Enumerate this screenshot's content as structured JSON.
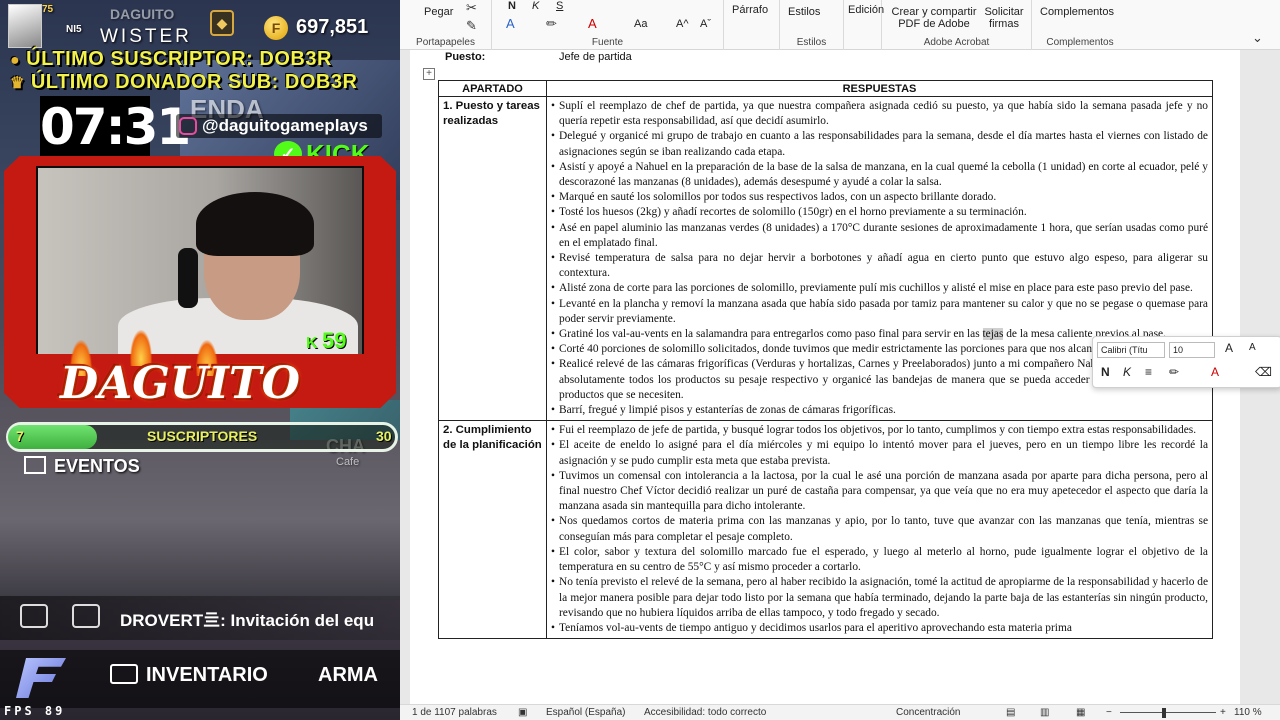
{
  "stream": {
    "player_name": "WISTER",
    "player_tag": "DAGUITO",
    "level": "75",
    "nis": "NI5",
    "coins": "697,851",
    "ticker1": "ÚLTIMO SUSCRIPTOR: DOB3R",
    "ticker2": "ÚLTIMO DONADOR SUB: DOB3R",
    "clock": "07:31",
    "instagram": "@daguitogameplays",
    "kick": "KICK",
    "kick_viewers": "59",
    "name_plate": "DAGUITO",
    "sub_current": "7",
    "sub_label": "SUSCRIPTORES",
    "sub_goal": "30",
    "sub_progress": 0.23,
    "events": "EVENTOS",
    "chat_message": "DROVERT亖: Invitación del equ",
    "inventory": "INVENTARIO",
    "weapon": "ARMA",
    "fps_label": "FPS",
    "fps_value": "89",
    "bg_text_1": "ENDA",
    "bg_text_2": "CHA",
    "bg_text_3": "Cafe"
  },
  "ribbon": {
    "pegar": "Pegar",
    "portapapeles": "Portapapeles",
    "fuente": "Fuente",
    "parrafo": "Párrafo",
    "estilos": "Estilos",
    "estilos_group": "Estilos",
    "edicion": "Edición",
    "crear_pdf": "Crear y compartir PDF de Adobe",
    "solicitar_firmas": "Solicitar firmas",
    "adobe_group": "Adobe Acrobat",
    "complementos": "Complementos",
    "complementos_group": "Complementos",
    "bold": "N",
    "italic": "K",
    "underline": "S",
    "grow": "A^",
    "shrink": "Aˇ",
    "aa": "Aa"
  },
  "mini_toolbar": {
    "font": "Calibri (Títu",
    "size": "10",
    "bold": "N",
    "italic": "K"
  },
  "document": {
    "puesto_label": "Puesto:",
    "puesto_value": "Jefe de partida",
    "col1": "APARTADO",
    "col2": "RESPUESTAS",
    "section1": "1. Puesto y tareas realizadas",
    "section1_items": [
      "Suplí el reemplazo de chef de partida, ya que nuestra compañera asignada cedió su puesto, ya que había sido la semana pasada jefe y no quería repetir esta responsabilidad, así que decidí asumirlo.",
      "Delegué y organicé mi grupo de trabajo en cuanto a las responsabilidades para la semana, desde el día martes hasta el viernes con listado de asignaciones según se iban realizando cada etapa.",
      "Asistí y apoyé a Nahuel en la preparación de la base de la salsa de manzana, en la cual quemé la cebolla (1 unidad) en corte al ecuador, pelé y descorazoné las manzanas (8 unidades), además desespumé y ayudé a colar la salsa.",
      "Marqué en sauté los solomillos por todos sus respectivos lados, con un aspecto brillante dorado.",
      "Tosté los huesos (2kg) y añadí recortes de solomillo (150gr) en el horno previamente a su terminación.",
      "Asé en papel aluminio las manzanas verdes (8 unidades) a 170°C durante sesiones de aproximadamente 1 hora, que serían usadas como puré en el emplatado final.",
      "Revisé temperatura de salsa para no dejar hervir a borbotones y añadí agua en cierto punto que estuvo algo espeso, para aligerar su contextura.",
      "Alisté zona de corte para las porciones de solomillo, previamente pulí mis cuchillos y alisté el mise en place para este paso previo del pase.",
      "Levanté en la plancha y removí la manzana asada que había sido pasada por tamiz para mantener su calor y que no se pegase o quemase para poder servir previamente.",
      "Gratiné los val-au-vents en la salamandra para entregarlos como paso final para servir en las tejas de la mesa caliente previos al pase.",
      "Corté 40 porciones de solomillo solicitados, donde tuvimos que medir estrictamente las porciones para que nos alcanzara dicha proteína.",
      "Realicé relevé de las cámaras frigoríficas (Verduras y hortalizas, Carnes y Preelaborados) junto a mi compañero Nahuel, en el cual escribí en absolutamente todos los productos su pesaje respectivo y organicé las bandejas de manera que se pueda acceder de manera sencilla a los productos que se necesiten.",
      "Barrí, fregué y limpié pisos y estanterías de zonas de cámaras frigoríficas."
    ],
    "section2": "2. Cumplimiento de la planificación",
    "section2_items": [
      "Fui el reemplazo de jefe de partida, y busqué lograr todos los objetivos, por lo tanto, cumplimos y con tiempo extra estas responsabilidades.",
      "El aceite de eneldo lo asigné para el día miércoles y mi equipo lo intentó mover para el jueves, pero en un tiempo libre les recordé la asignación y se pudo cumplir esta meta que estaba prevista.",
      "Tuvimos un comensal con intolerancia a la lactosa, por la cual le asé una porción de manzana asada por aparte para dicha persona, pero al final nuestro Chef Víctor decidió realizar un puré de castaña para compensar, ya que veía que no era muy apetecedor el aspecto que daría la manzana asada sin mantequilla para dicho intolerante.",
      "Nos quedamos cortos de materia prima con las manzanas y apio, por lo tanto, tuve que avanzar con las manzanas que tenía, mientras se conseguían más para completar el pesaje completo.",
      "El color, sabor y textura del solomillo marcado fue el esperado, y luego al meterlo al horno, pude igualmente lograr el objetivo de la temperatura en su centro de 55°C y así mismo proceder a cortarlo.",
      "No tenía previsto el relevé de la semana, pero al haber recibido la asignación, tomé la actitud de apropiarme de la responsabilidad y hacerlo de la mejor manera posible para dejar todo listo por la semana que había terminado, dejando la parte baja de las estanterías sin ningún producto, revisando que no hubiera líquidos arriba de ellas tampoco, y todo fregado y secado.",
      "Teníamos vol-au-vents de tiempo antiguo y decidimos usarlos para el aperitivo aprovechando esta materia prima"
    ]
  },
  "status": {
    "page": "1 de 1107 palabras",
    "language": "Español (España)",
    "accessibility": "Accesibilidad: todo correcto",
    "focus": "Concentración",
    "zoom": "110 %"
  }
}
